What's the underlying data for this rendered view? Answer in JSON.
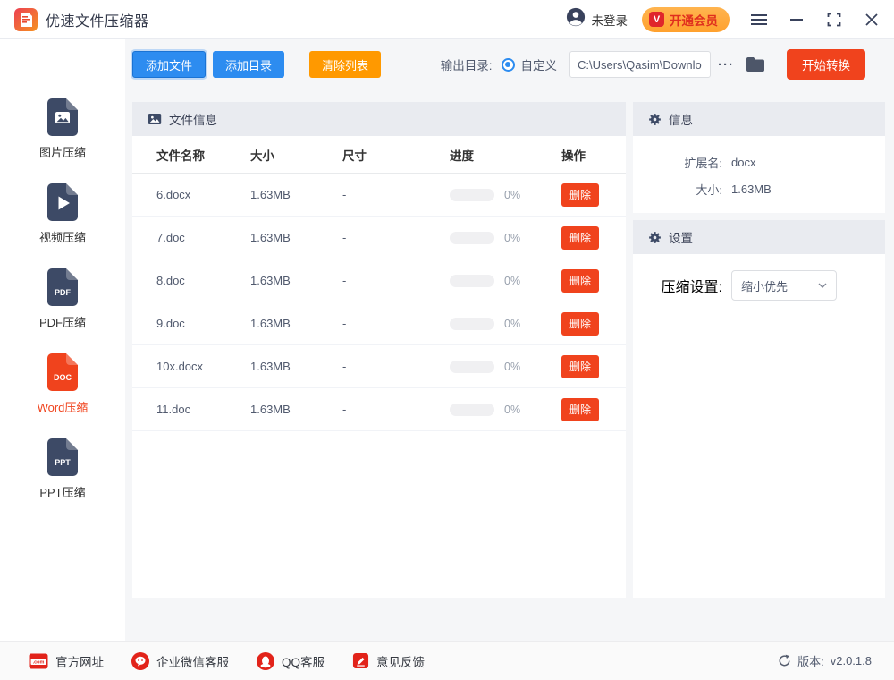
{
  "titlebar": {
    "app_title": "优速文件压缩器",
    "login_status": "未登录",
    "vip_badge": "V",
    "vip_label": "开通会员"
  },
  "toolbar": {
    "add_file": "添加文件",
    "add_dir": "添加目录",
    "clear_list": "清除列表",
    "output_dir_label": "输出目录:",
    "custom_option": "自定义",
    "output_path": "C:\\Users\\Qasim\\Downlo",
    "more_button": "···",
    "start_button": "开始转换"
  },
  "sidebar": {
    "items": [
      {
        "label": "图片压缩",
        "badge": ""
      },
      {
        "label": "视频压缩",
        "badge": ""
      },
      {
        "label": "PDF压缩",
        "badge": "PDF"
      },
      {
        "label": "Word压缩",
        "badge": "DOC"
      },
      {
        "label": "PPT压缩",
        "badge": "PPT"
      }
    ]
  },
  "file_panel": {
    "title": "文件信息",
    "columns": [
      "文件名称",
      "大小",
      "尺寸",
      "进度",
      "操作"
    ],
    "rows": [
      {
        "name": "6.docx",
        "size": "1.63MB",
        "dimension": "-",
        "progress": "0%",
        "action": "删除"
      },
      {
        "name": "7.doc",
        "size": "1.63MB",
        "dimension": "-",
        "progress": "0%",
        "action": "删除"
      },
      {
        "name": "8.doc",
        "size": "1.63MB",
        "dimension": "-",
        "progress": "0%",
        "action": "删除"
      },
      {
        "name": "9.doc",
        "size": "1.63MB",
        "dimension": "-",
        "progress": "0%",
        "action": "删除"
      },
      {
        "name": "10x.docx",
        "size": "1.63MB",
        "dimension": "-",
        "progress": "0%",
        "action": "删除"
      },
      {
        "name": "11.doc",
        "size": "1.63MB",
        "dimension": "-",
        "progress": "0%",
        "action": "删除"
      }
    ]
  },
  "info_panel": {
    "title": "信息",
    "rows": [
      {
        "label": "扩展名:",
        "value": "docx"
      },
      {
        "label": "大小:",
        "value": "1.63MB"
      }
    ]
  },
  "settings_panel": {
    "title": "设置",
    "label": "压缩设置:",
    "value": "缩小优先"
  },
  "footer": {
    "links": [
      {
        "label": "官方网址",
        "icon_text": ".com"
      },
      {
        "label": "企业微信客服"
      },
      {
        "label": "QQ客服"
      },
      {
        "label": "意见反馈"
      }
    ],
    "version_label": "版本:",
    "version_value": "v2.0.1.8"
  },
  "colors": {
    "primary_blue": "#2d8cf0",
    "warning_orange": "#ff9900",
    "accent_red": "#f0431d",
    "sidebar_icon": "#3d4a66",
    "panel_header_bg": "#e9ebf0",
    "footer_icon_red": "#e2231a",
    "vip_pill_bg": "#ffa93d",
    "vip_text": "#e02f1e"
  }
}
